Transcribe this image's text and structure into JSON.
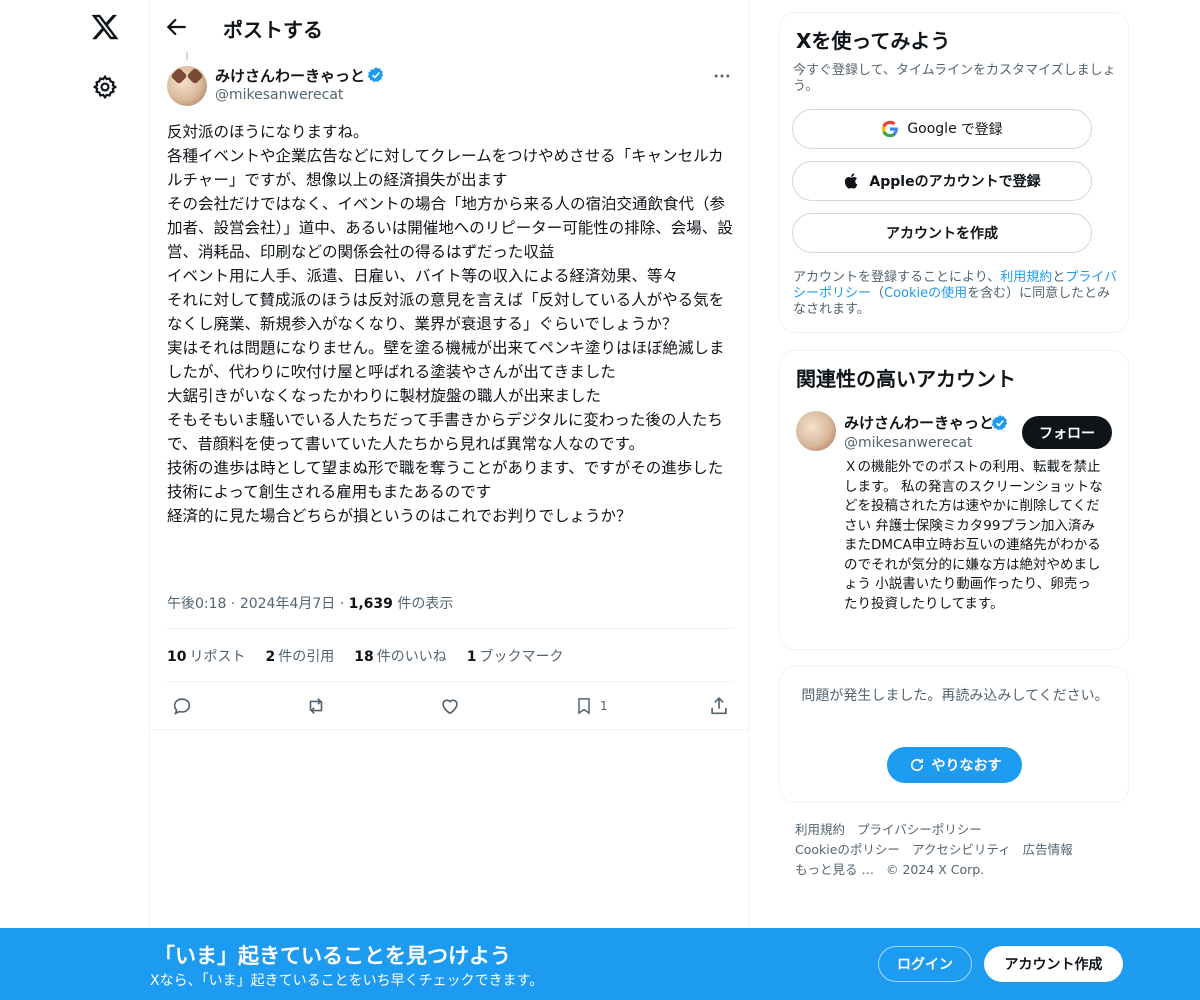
{
  "header": {
    "title": "ポストする"
  },
  "post": {
    "author_name": "みけさんわーきゃっと",
    "author_handle": "@mikesanwerecat",
    "body": "反対派のほうになりますね。\n各種イベントや企業広告などに対してクレームをつけやめさせる「キャンセルカルチャー」ですが、想像以上の経済損失が出ます\nその会社だけではなく、イベントの場合「地方から来る人の宿泊交通飲食代（参加者、設営会社）」道中、あるいは開催地へのリピーター可能性の排除、会場、設営、消耗品、印刷などの関係会社の得るはずだった収益\nイベント用に人手、派遣、日雇い、バイト等の収入による経済効果、等々\nそれに対して賛成派のほうは反対派の意見を言えば「反対している人がやる気をなくし廃業、新規参入がなくなり、業界が衰退する」ぐらいでしょうか？\n実はそれは問題になりません。壁を塗る機械が出来てペンキ塗りはほぼ絶滅しましたが、代わりに吹付け屋と呼ばれる塗装やさんが出てきました\n大鋸引きがいなくなったかわりに製材旋盤の職人が出来ました\nそもそもいま騒いでいる人たちだって手書きからデジタルに変わった後の人たちで、昔顔料を使って書いていた人たちから見れば異常な人なのです。\n技術の進歩は時として望まぬ形で職を奪うことがあります、ですがその進歩した技術によって創生される雇用もまたあるのです\n経済的に見た場合どちらが損というのはこれでお判りでしょうか？",
    "time": "午後0:18",
    "date": "2024年4月7日",
    "views_count": "1,639",
    "views_label": "件の表示",
    "stats": [
      {
        "count": "10",
        "label": "リポスト"
      },
      {
        "count": "2",
        "label": "件の引用"
      },
      {
        "count": "18",
        "label": "件のいいね"
      },
      {
        "count": "1",
        "label": "ブックマーク"
      }
    ],
    "bookmark_count": "1"
  },
  "signup_card": {
    "title": "Xを使ってみよう",
    "subtitle": "今すぐ登録して、タイムラインをカスタマイズしましょう。",
    "google_brand": "Google",
    "google_suffix": "で登録",
    "apple_label": "Appleのアカウントで登録",
    "create_label": "アカウントを作成",
    "legal_1": "アカウントを登録することにより、",
    "legal_terms": "利用規約",
    "legal_and": "と",
    "legal_privacy": "プライバシーポリシー",
    "legal_open": "（",
    "legal_cookie": "Cookieの使用",
    "legal_2": "を含む）に同意したとみなされます。"
  },
  "related_card": {
    "title": "関連性の高いアカウント",
    "name": "みけさんわーきゃっと",
    "handle": "@mikesanwerecat",
    "follow_label": "フォロー",
    "bio": "Ｘの機能外でのポストの利用、転載を禁止します。 私の発言のスクリーンショットなどを投稿された方は速やかに削除してください 弁護士保険ミカタ99プラン加入済み またDMCA申立時お互いの連絡先がわかるのでそれが気分的に嫌な方は絶対やめましょう 小説書いたり動画作ったり、卵売ったり投資したりしてます。"
  },
  "error_card": {
    "message": "問題が発生しました。再読み込みしてください。",
    "retry_label": "やりなおす"
  },
  "footer": {
    "links": [
      "利用規約",
      "プライバシーポリシー",
      "Cookieのポリシー",
      "アクセシビリティ",
      "広告情報",
      "もっと見る …"
    ],
    "copyright": "© 2024 X Corp."
  },
  "bottom_bar": {
    "title": "「いま」起きていることを見つけよう",
    "subtitle": "Xなら、「いま」起きていることをいち早くチェックできます。",
    "login_label": "ログイン",
    "create_label": "アカウント作成"
  },
  "colors": {
    "accent": "#1d9bf0",
    "text": "#0f1419",
    "muted": "#536471",
    "border": "#eff3f4"
  }
}
